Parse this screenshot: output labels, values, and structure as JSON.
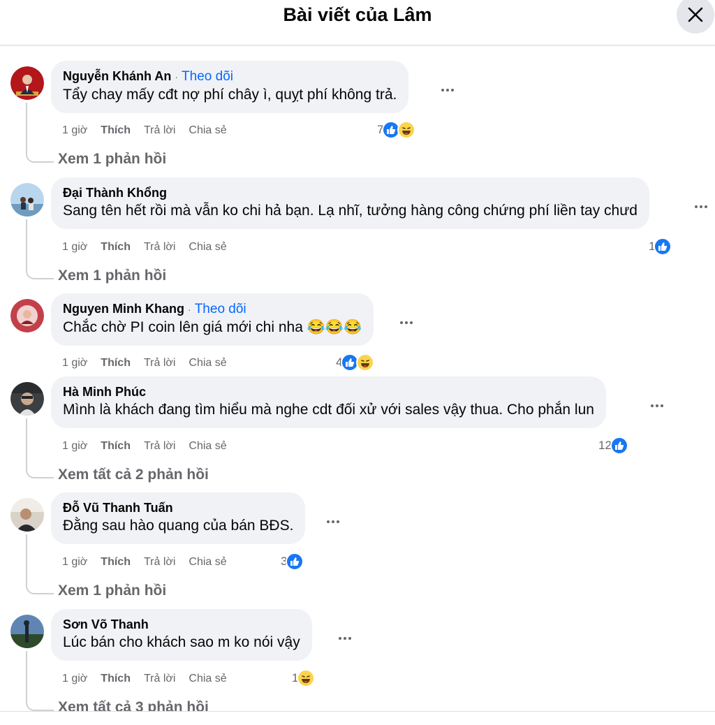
{
  "header": {
    "title": "Bài viết của Lâm",
    "close_icon": "close-icon"
  },
  "actions_labels": {
    "like": "Thích",
    "reply": "Trả lời",
    "share": "Chia sẻ"
  },
  "comments": [
    {
      "author": "Nguyễn Khánh An",
      "sep": "·",
      "follow": "Theo dõi",
      "text": "Tẩy chay mấy cđt nợ phí chây ì, quỵt phí không trả.",
      "time": "1 giờ",
      "reaction_count": "7",
      "reactions": [
        "like",
        "haha"
      ],
      "replies": "Xem 1 phản hồi"
    },
    {
      "author": "Đại Thành Khổng",
      "text": "Sang tên hết rồi mà vẫn ko chi hả bạn. Lạ nhĩ, tưởng hàng công chứng phí liền tay chưd",
      "time": "1 giờ",
      "reaction_count": "1",
      "reactions": [
        "like"
      ],
      "replies": "Xem 1 phản hồi"
    },
    {
      "author": "Nguyen Minh Khang",
      "sep": "·",
      "follow": "Theo dõi",
      "text": "Chắc chờ PI coin lên giá mới chi nha 😂😂😂",
      "time": "1 giờ",
      "reaction_count": "4",
      "reactions": [
        "like",
        "haha"
      ]
    },
    {
      "author": "Hà Minh Phúc",
      "text": "Mình là khách đang tìm hiểu mà nghe cdt đối xử với sales vậy thua. Cho phắn lun",
      "time": "1 giờ",
      "reaction_count": "12",
      "reactions": [
        "like"
      ],
      "replies": "Xem tất cả 2 phản hồi"
    },
    {
      "author": "Đỗ Vũ Thanh Tuấn",
      "text": "Đằng sau hào quang của bán BĐS.",
      "time": "1 giờ",
      "reaction_count": "3",
      "reactions": [
        "like"
      ],
      "replies": "Xem 1 phản hồi"
    },
    {
      "author": "Sơn Võ Thanh",
      "text": "Lúc bán cho khách sao m ko nói vậy",
      "time": "1 giờ",
      "reaction_count": "1",
      "reactions": [
        "haha"
      ],
      "replies": "Xem tất cả 3 phản hồi"
    }
  ]
}
